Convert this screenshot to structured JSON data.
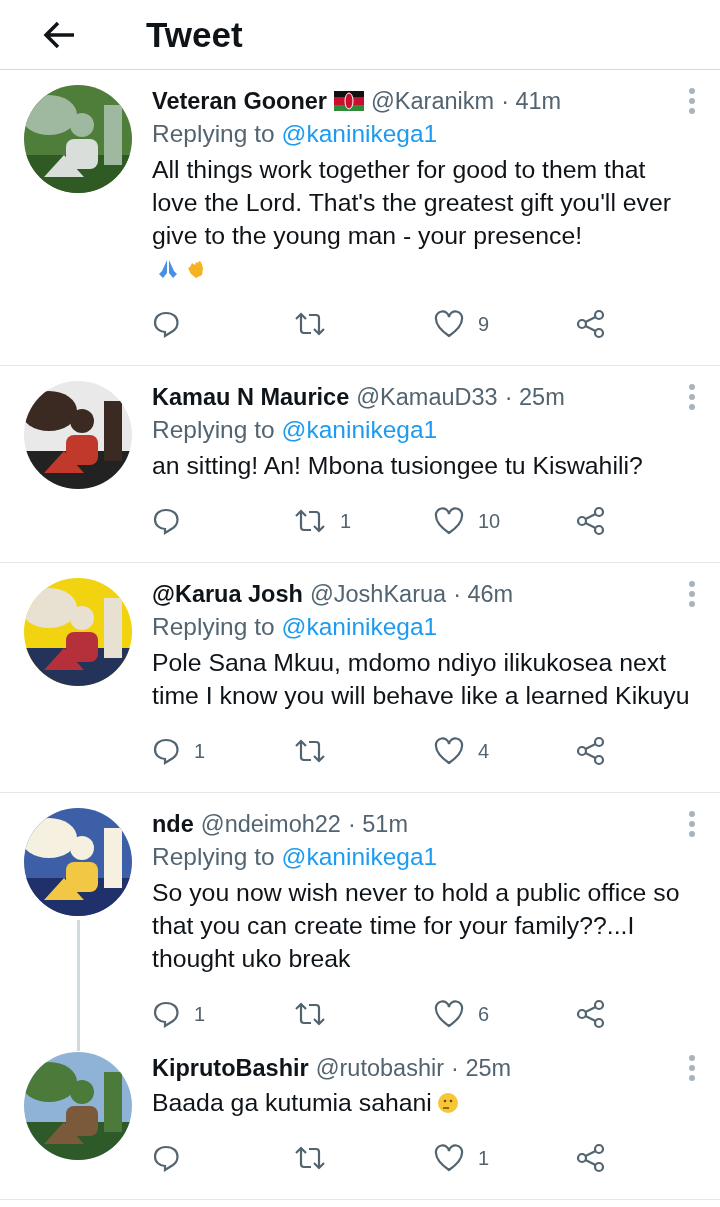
{
  "header": {
    "title": "Tweet"
  },
  "replies": [
    {
      "name": "Veteran Gooner",
      "flag": true,
      "handle": "@Karanikm",
      "time": "· 41m",
      "replying_prefix": "Replying to",
      "replying_to": "@kaninikega1",
      "text": "All things work together for good to them that love the Lord. That's the greatest gift you'll ever give to the young man - your presence!",
      "emojis": [
        {
          "kind": "pray"
        },
        {
          "kind": "clap"
        }
      ],
      "counts": {
        "like": "9"
      },
      "connected_below": false
    },
    {
      "name": "Kamau N Maurice",
      "flag": false,
      "handle": "@KamauD33",
      "time": "· 25m",
      "replying_prefix": "Replying to",
      "replying_to": "@kaninikega1",
      "text": "an sitting! An! Mbona tusiongee tu Kiswahili?",
      "counts": {
        "retweet": "1",
        "like": "10"
      },
      "connected_below": false
    },
    {
      "name": "@Karua Josh",
      "flag": false,
      "handle": "@JoshKarua",
      "time": "· 46m",
      "replying_prefix": "Replying to",
      "replying_to": "@kaninikega1",
      "text": "Pole Sana Mkuu, mdomo ndiyo ilikukosea next time I know you will behave like a learned Kikuyu",
      "counts": {
        "reply": "1",
        "like": "4"
      },
      "connected_below": false
    },
    {
      "name": "nde",
      "flag": false,
      "handle": "@ndeimoh22",
      "time": "· 51m",
      "replying_prefix": "Replying to",
      "replying_to": "@kaninikega1",
      "text": "So you now wish never to hold a public office so that you can create time for your family??...I thought uko break",
      "counts": {
        "reply": "1",
        "like": "6"
      },
      "connected_below": true
    },
    {
      "name": "KiprutoBashir",
      "flag": false,
      "handle": "@rutobashir",
      "time": "· 25m",
      "text": "Baada ga kutumia sahani",
      "emojis": [
        {
          "kind": "thinking"
        }
      ],
      "counts": {
        "like": "1"
      },
      "connected_below": false
    }
  ]
}
